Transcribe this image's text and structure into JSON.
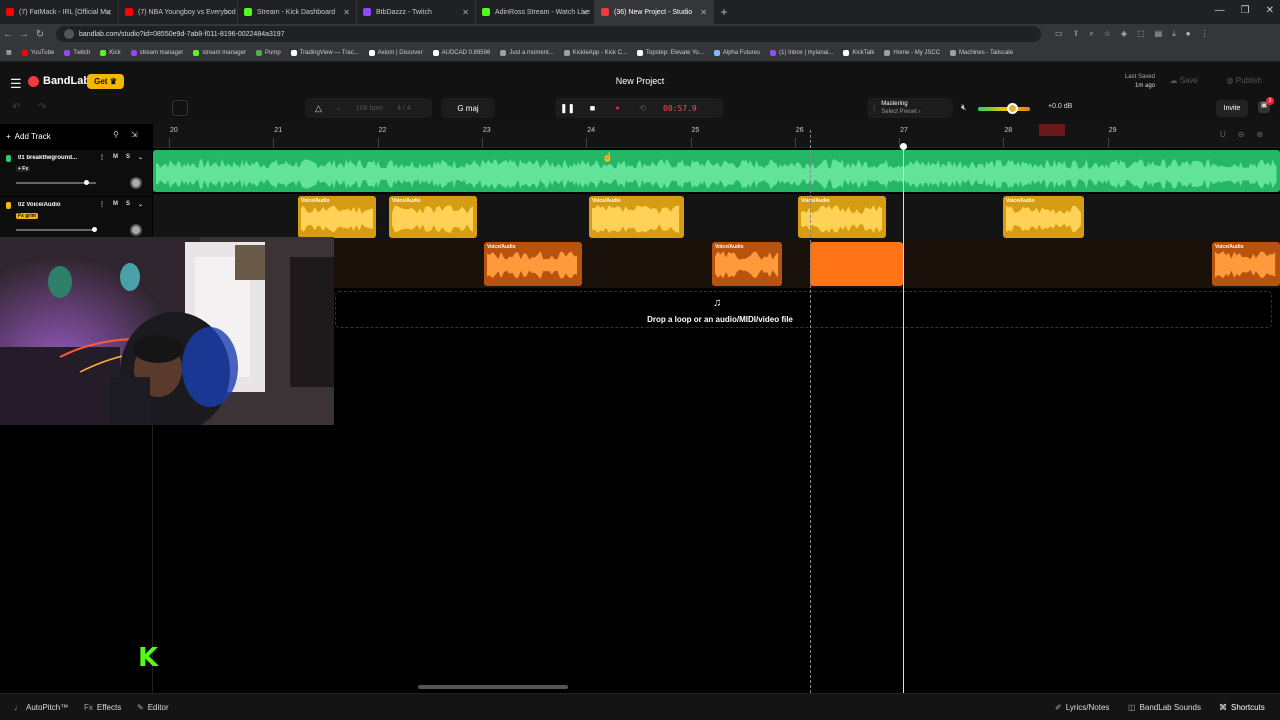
{
  "browser": {
    "tabs": [
      {
        "label": "(7) FatMack - IRL [Official Mu",
        "color": "#ff0000"
      },
      {
        "label": "(7) NBA Youngboy vs Everybod",
        "color": "#ff0000"
      },
      {
        "label": "Stream - Kick Dashboard",
        "color": "#53fc18"
      },
      {
        "label": "BtbDazzz - Twitch",
        "color": "#9146ff"
      },
      {
        "label": "AdinRoss Stream - Watch Live",
        "color": "#53fc18"
      },
      {
        "label": "(36) New Project - Studio",
        "color": "#f03b3b"
      }
    ],
    "url": "bandlab.com/studio?id=08550e9d-7ab8-f011-8196-0022484a3197",
    "bookmarks": [
      {
        "label": "YouTube",
        "color": "#ff0000"
      },
      {
        "label": "Twitch",
        "color": "#9146ff"
      },
      {
        "label": "Kick",
        "color": "#53fc18"
      },
      {
        "label": "stream manager",
        "color": "#9146ff"
      },
      {
        "label": "stream manager",
        "color": "#53fc18"
      },
      {
        "label": "Pump",
        "color": "#4caf50"
      },
      {
        "label": "TradingView — Trac...",
        "color": "#ffffff"
      },
      {
        "label": "Axiom | Discover",
        "color": "#ffffff"
      },
      {
        "label": "AUDCAD 0.89596",
        "color": "#ffffff"
      },
      {
        "label": "Just a moment...",
        "color": "#9aa0a6"
      },
      {
        "label": "KickleApp - Kick C...",
        "color": "#9aa0a6"
      },
      {
        "label": "Topstep: Elevate Yo...",
        "color": "#ffffff"
      },
      {
        "label": "Alpha Futures",
        "color": "#8ab4f8"
      },
      {
        "label": "(1) Inbox | mylanai...",
        "color": "#8a4fff"
      },
      {
        "label": "KickTalk",
        "color": "#ffffff"
      },
      {
        "label": "Home - My JSCC",
        "color": "#9aa0a6"
      },
      {
        "label": "Machines - Tailscale",
        "color": "#9aa0a6"
      }
    ]
  },
  "app": {
    "brand": "BandLab",
    "get_label": "Get",
    "project_title": "New Project",
    "last_saved_label": "Last Saved",
    "last_saved_value": "1m ago",
    "save_label": "Save",
    "publish_label": "Publish",
    "invite_label": "Invite",
    "gift_badge": "3"
  },
  "toolbar": {
    "bpm_value": "108",
    "bpm_unit": "bpm",
    "time_signature": "4 / 4",
    "key": "G maj",
    "timecode": "00:57.9",
    "mastering_label": "Mastering",
    "mastering_preset": "Select Preset",
    "volume_db": "+0.0 dB",
    "volume_level": 0.67
  },
  "tracks_panel": {
    "add_track_label": "Add Track",
    "tracks": [
      {
        "number_name": "01  breaktheground...",
        "fx": "+ Fx",
        "rec_color": "#2ecc71",
        "fx_color": "#2ecc71",
        "volume": 0.87
      },
      {
        "number_name": "02  Voice/Audio",
        "fx": "Fx grim",
        "rec_color": "#f5b800",
        "fx_color": "#f5b800",
        "volume": 0.98
      }
    ],
    "mute_label": "M",
    "solo_label": "S"
  },
  "timeline": {
    "bars": [
      "20",
      "21",
      "22",
      "23",
      "24",
      "25",
      "26",
      "27",
      "28",
      "29"
    ],
    "region_label": "Voice/Audio",
    "drop_text": "Drop a loop or an audio/MIDI/video file"
  },
  "footer": {
    "autopitch": "AutoPitch™",
    "effects": "Effects",
    "editor": "Editor",
    "lyrics": "Lyrics/Notes",
    "sounds": "BandLab Sounds",
    "shortcuts": "Shortcuts"
  },
  "colors": {
    "track1": "#27c870",
    "track2": "#f5b800",
    "track3": "#f07a1a",
    "accent_red": "#ff4d4d"
  }
}
